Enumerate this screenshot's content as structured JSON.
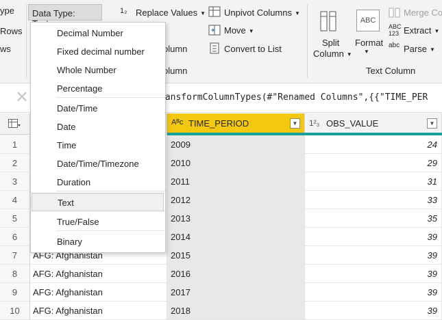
{
  "ribbon": {
    "left_items": [
      "Rows",
      "ws"
    ],
    "data_type_label": "Data Type: Text",
    "type_prefix": "ype",
    "replace_values": "Replace Values",
    "unpivot_columns": "Unpivot Columns",
    "move": "Move",
    "convert_to_list": "Convert to List",
    "column_fragment": "olumn",
    "column_group_fragment": "olumn",
    "split_column_line1": "Split",
    "split_column_line2": "Column",
    "format": "Format",
    "merge_columns": "Merge Co",
    "extract": "Extract",
    "parse": "Parse",
    "text_column_group": "Text Column",
    "icon_replace": "1₂",
    "icon_abc": "ABC",
    "icon_abc123": "ABC\n123",
    "icon_abc_parse": "abc"
  },
  "formula_bar": {
    "text": "ransformColumnTypes(#\"Renamed Columns\",{{\"TIME_PER"
  },
  "grid": {
    "columns": [
      {
        "name": "",
        "type_icon": ""
      },
      {
        "name": "TIME_PERIOD",
        "type_icon": "Aᴮᴄ"
      },
      {
        "name": "OBS_VALUE",
        "type_icon": "1²₃"
      }
    ],
    "rows": [
      {
        "n": "1",
        "country": "",
        "period": "2009",
        "value": "24"
      },
      {
        "n": "2",
        "country": "",
        "period": "2010",
        "value": "29"
      },
      {
        "n": "3",
        "country": "",
        "period": "2011",
        "value": "31"
      },
      {
        "n": "4",
        "country": "",
        "period": "2012",
        "value": "33"
      },
      {
        "n": "5",
        "country": "",
        "period": "2013",
        "value": "35"
      },
      {
        "n": "6",
        "country": "",
        "period": "2014",
        "value": "39"
      },
      {
        "n": "7",
        "country": "AFG: Afghanistan",
        "period": "2015",
        "value": "39"
      },
      {
        "n": "8",
        "country": "AFG: Afghanistan",
        "period": "2016",
        "value": "39"
      },
      {
        "n": "9",
        "country": "AFG: Afghanistan",
        "period": "2017",
        "value": "39"
      },
      {
        "n": "10",
        "country": "AFG: Afghanistan",
        "period": "2018",
        "value": "39"
      }
    ]
  },
  "menu": {
    "items": [
      "Decimal Number",
      "Fixed decimal number",
      "Whole Number",
      "Percentage",
      "Date/Time",
      "Date",
      "Time",
      "Date/Time/Timezone",
      "Duration",
      "Text",
      "True/False",
      "Binary"
    ],
    "selected": "Text"
  },
  "colors": {
    "accent_teal": "#18a19a",
    "header_highlight": "#f2c811"
  }
}
